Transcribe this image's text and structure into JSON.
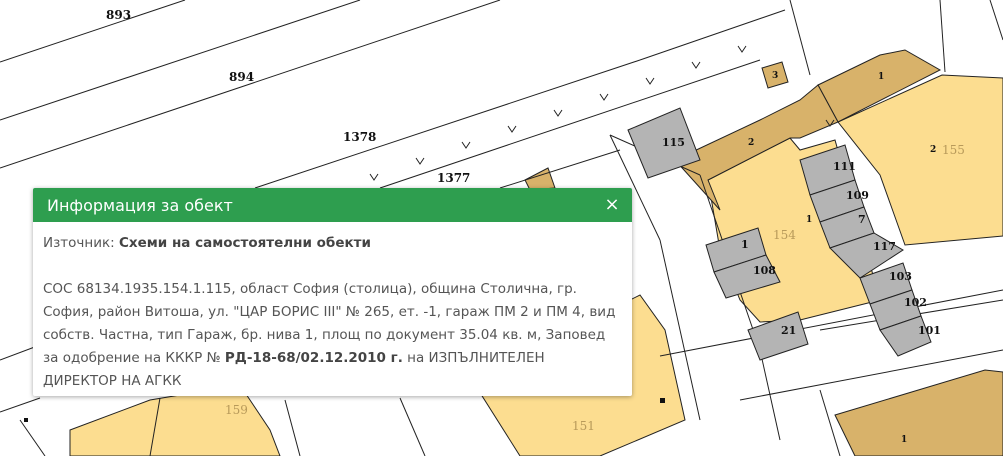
{
  "map": {
    "labels": {
      "p893": "893",
      "p894": "894",
      "p1378": "1378",
      "p1377": "1377",
      "p115": "115",
      "p3": "3",
      "p1_top": "1",
      "p2_left": "2",
      "p2_right": "2",
      "p155": "155",
      "p1_mid": "1",
      "p154": "154",
      "p111": "111",
      "p109": "109",
      "p7": "7",
      "p117": "117",
      "p103": "103",
      "p102": "102",
      "p101": "101",
      "p1_small": "1",
      "p108": "108",
      "p21": "21",
      "p159": "159",
      "p151": "151",
      "p1_bottom": "1"
    },
    "colors": {
      "building_tan": "#d8b26a",
      "building_light": "#fcdd90",
      "garage_gray": "#b4b4b4",
      "line": "#222222"
    }
  },
  "popup": {
    "title": "Информация за обект",
    "close_icon": "×",
    "source_label": "Източник: ",
    "source_value": "Схеми на самостоятелни обекти",
    "desc_main": "СОС 68134.1935.154.1.115, област София (столица), община Столична, гр. София, район Витоша, ул. \"ЦАР БОРИС III\" № 265, ет. -1, гараж ПМ 2 и ПМ 4, вид собств. Частна, тип Гараж, бр. нива 1, площ по документ 35.04 кв. м, Заповед за одобрение на КККР № ",
    "order_number": "РД-18-68/02.12.2010 г.",
    "desc_tail": " на ИЗПЪЛНИТЕЛЕН ДИРЕКТОР НА АГКК",
    "header_color": "#2e9e4f"
  }
}
